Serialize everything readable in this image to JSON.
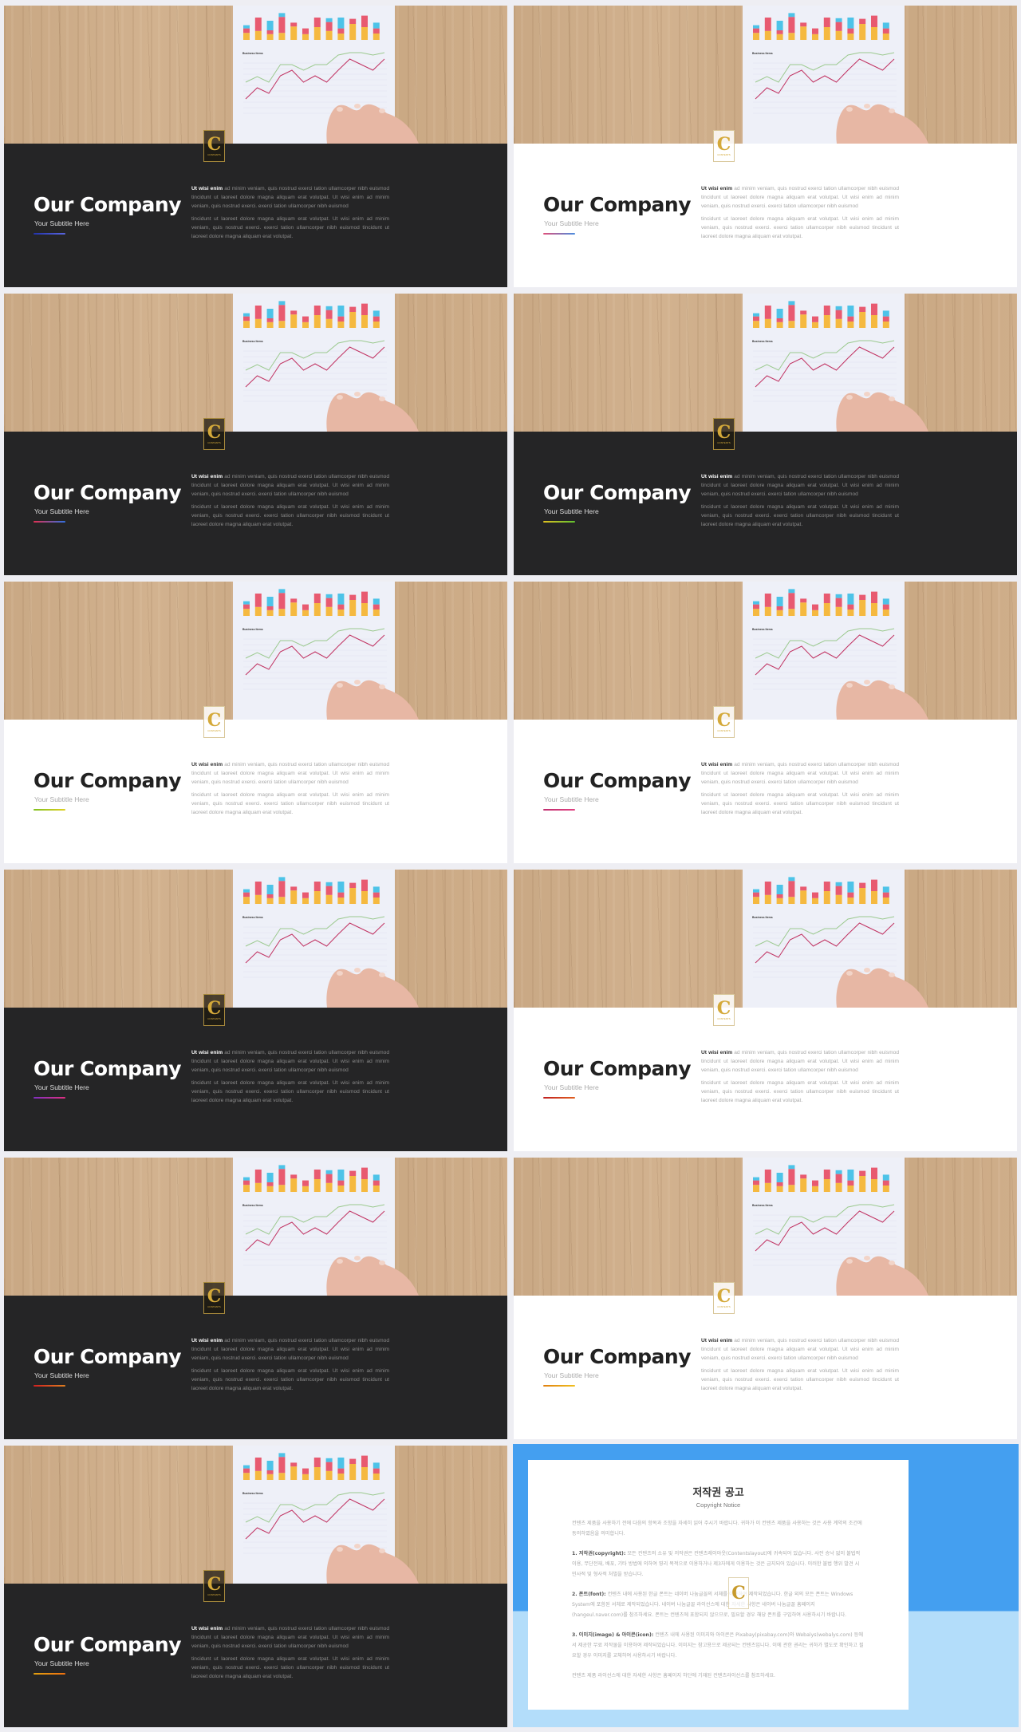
{
  "slide_common": {
    "title": "Our Company",
    "subtitle": "Your Subtitle Here",
    "body_lead": "Ut wisi enim",
    "body_p1": " ad minim veniam, quis nostrud exerci tation ullamcorper nibh euismod tincidunt ut laoreet dolore magna aliquam erat volutpat. Ut wisi enim ad minim veniam, quis nostrud exerci. exerci tation ullamcorper nibh euismod",
    "body_p2": "tincidunt ut laoreet dolore magna aliquam erat volutpat. Ut wisi enim ad minim veniam, quis nostrud exerci. exerci tation ullamcorper nibh euismod tincidunt ut laoreet dolore magna aliquam erat volutpat.",
    "logo_text": "CONTENTS"
  },
  "slides": [
    {
      "theme": "dark",
      "accent": [
        "#2233aa",
        "#5a66e0"
      ]
    },
    {
      "theme": "light",
      "accent": [
        "#e0507a",
        "#4a8ee0"
      ]
    },
    {
      "theme": "dark",
      "accent": [
        "#e03050",
        "#3070e0"
      ]
    },
    {
      "theme": "dark",
      "accent": [
        "#e0c020",
        "#60c030"
      ]
    },
    {
      "theme": "light",
      "accent": [
        "#80c020",
        "#e0d020"
      ]
    },
    {
      "theme": "light",
      "accent": [
        "#c03070",
        "#e04080"
      ]
    },
    {
      "theme": "dark",
      "accent": [
        "#8030c0",
        "#e03080"
      ]
    },
    {
      "theme": "light",
      "accent": [
        "#c02020",
        "#e06020"
      ]
    },
    {
      "theme": "dark",
      "accent": [
        "#d02020",
        "#e08020"
      ]
    },
    {
      "theme": "light",
      "accent": [
        "#e08010",
        "#f0c020"
      ]
    },
    {
      "theme": "dark",
      "accent": [
        "#e0a010",
        "#f07010"
      ]
    }
  ],
  "copyright": {
    "title": "저작권 공고",
    "subtitle": "Copyright Notice",
    "intro": "컨텐츠 제품을 사용하기 전에 다음의 항목과 조항을 자세히 읽어 주시기 바랍니다. 귀하가 이 컨텐츠 제품을 사용하는 것은 사용 계약의 조건에 동의하였음을 의미합니다.",
    "items": [
      {
        "label": "1. 저작권(copyright):",
        "text": " 모든 컨텐츠의 소유 및 저작권은 컨텐츠레이아웃(Contentslayout)에 귀속되어 있습니다. 사전 승낙 없이 불법적 이용, 무단전재, 배포, 기타 방법에 의하여 영리 목적으로 이용하거나 제3자에게 이용하는 것은 금지되어 있습니다. 이러한 불법 행위 발견 시 민사적 및 형사적 처벌을 받습니다."
      },
      {
        "label": "2. 폰트(font):",
        "text": " 컨텐츠 내에 사용된 한글 폰트는 네이버 나눔글꼴의 서체를 이용하여 제작되었습니다. 한글 외의 모든 폰트는 Windows System에 포함된 서체로 제작되었습니다. 네이버 나눔글꼴 라이선스에 대한 자세한 사항은 네이버 나눔글꼴 홈페이지(hangeul.naver.com)를 참조하세요. 폰트는 컨텐츠에 포함되지 않으므로, 필요할 경우 해당 폰트를 구입하여 사용하시기 바랍니다."
      },
      {
        "label": "3. 이미지(image) & 아이콘(icon):",
        "text": " 컨텐츠 내에 사용된 이미지와 아이콘은 Pixabay(pixabay.com)와 Webalys(webalys.com) 등에서 제공한 무료 저작물을 이용하여 제작되었습니다. 이미지는 참고용으로 제공되는 컨텐츠입니다. 이에 관한 권리는 귀하가 별도로 확인하고 필요할 경우 이미지를 교체하여 사용하시기 바랍니다."
      }
    ],
    "footer": "컨텐츠 제품 라이선스에 대한 자세한 사항은 홈페이지 하단에 기재된 컨텐츠라이선스를 참조하세요.",
    "colors": {
      "top": "#449ff0",
      "bottom": "#b3ddfa"
    }
  }
}
